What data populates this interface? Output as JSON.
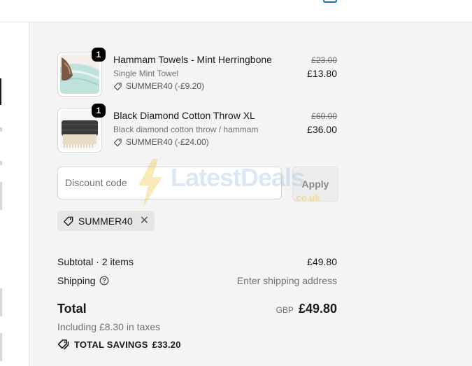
{
  "cart": {
    "items": [
      {
        "name": "Hammam Towels - Mint Herringbone",
        "variant": "Single Mint Towel",
        "discount": "SUMMER40 (-£9.20)",
        "original_price": "£23.00",
        "price": "£13.80",
        "quantity": "1",
        "thumb_color": "#bfe3dc"
      },
      {
        "name": "Black Diamond Cotton Throw XL",
        "variant": "Black diamond cotton throw / hammam",
        "discount": "SUMMER40 (-£24.00)",
        "original_price": "£60.00",
        "price": "£36.00",
        "quantity": "1",
        "thumb_color": "#3a3a3a"
      }
    ]
  },
  "discount": {
    "placeholder": "Discount code",
    "apply_label": "Apply",
    "applied_code": "SUMMER40"
  },
  "summary": {
    "subtotal_label": "Subtotal · 2 items",
    "subtotal_value": "£49.80",
    "shipping_label": "Shipping",
    "shipping_value": "Enter shipping address",
    "total_label": "Total",
    "currency": "GBP",
    "total_value": "£49.80",
    "tax_note": "Including £8.30 in taxes",
    "savings_label": "TOTAL SAVINGS",
    "savings_value": "£33.20"
  },
  "watermark": {
    "text": "LatestDeals",
    "sub": ".co.uk"
  },
  "colors": {
    "summary_bg": "#f4f4f4",
    "accent": "#1f6fa7"
  }
}
